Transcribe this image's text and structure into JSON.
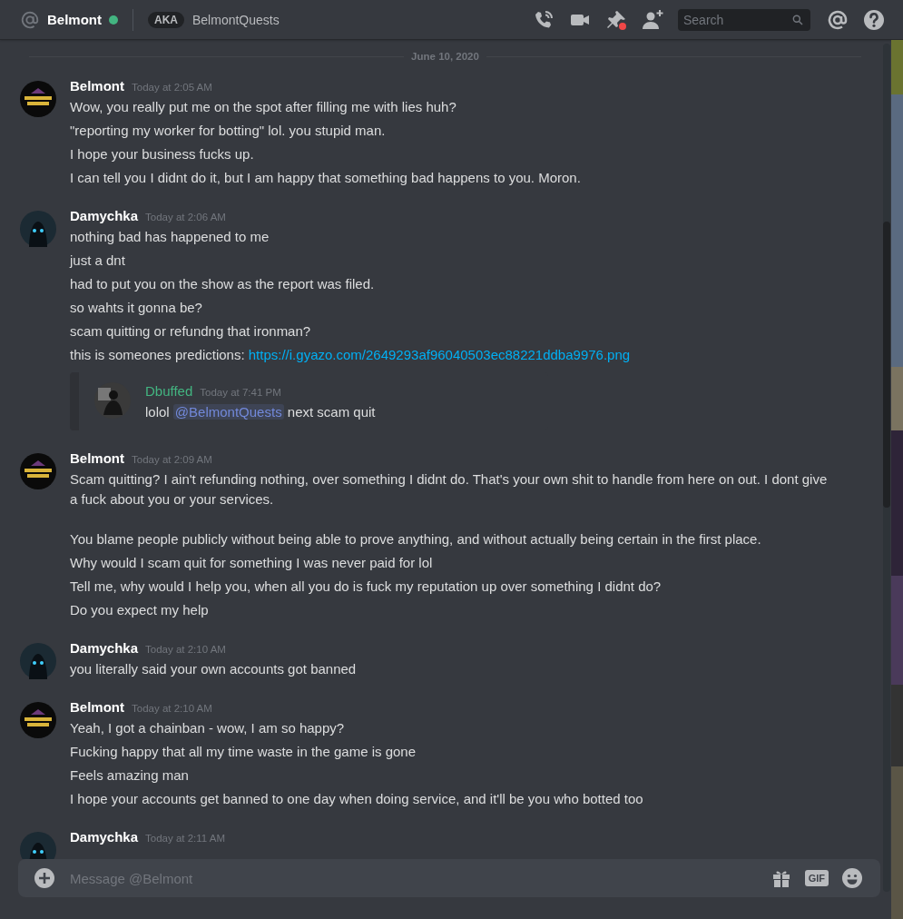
{
  "header": {
    "title": "Belmont",
    "online": true,
    "aka_badge": "AKA",
    "aka_name": "BelmontQuests",
    "search_placeholder": "Search"
  },
  "date_divider": "June 10, 2020",
  "messages": [
    {
      "author": "Belmont",
      "kind": "logo",
      "color": "#ffffff",
      "time": "Today at 2:05 AM",
      "paragraphs": [
        [
          [
            {
              "kind": "text",
              "text": "Wow, you really put me on the spot after filling me with lies huh?"
            }
          ],
          [
            {
              "kind": "text",
              "text": "\"reporting my worker for botting\" lol. you stupid man."
            }
          ],
          [
            {
              "kind": "text",
              "text": "I hope your business fucks up."
            }
          ],
          [
            {
              "kind": "text",
              "text": "I can tell you I didnt do it, but I am happy that something bad happens to you. Moron."
            }
          ]
        ]
      ]
    },
    {
      "author": "Damychka",
      "kind": "mask",
      "color": "#ffffff",
      "time": "Today at 2:06 AM",
      "paragraphs": [
        [
          [
            {
              "kind": "text",
              "text": "nothing bad has happened to me"
            }
          ],
          [
            {
              "kind": "text",
              "text": "just a dnt"
            }
          ],
          [
            {
              "kind": "text",
              "text": "had to put you on the show as the report was filed."
            }
          ],
          [
            {
              "kind": "text",
              "text": "so wahts it gonna be?"
            }
          ],
          [
            {
              "kind": "text",
              "text": "scam quitting or refundng that ironman?"
            }
          ],
          [
            {
              "kind": "text",
              "text": "this is someones predictions:"
            },
            {
              "kind": "link",
              "text": "https://i.gyazo.com/2649293af96040503ec88221ddba9976.png"
            }
          ]
        ]
      ],
      "embed": {
        "author": "Dbuffed",
        "color": "#43b581",
        "time": "Today at 7:41 PM",
        "parts": [
          {
            "kind": "text",
            "text": "lolol"
          },
          {
            "kind": "mention",
            "text": "@BelmontQuests"
          },
          {
            "kind": "text",
            "text": "next scam quit"
          }
        ]
      }
    },
    {
      "author": "Belmont",
      "kind": "logo",
      "color": "#ffffff",
      "time": "Today at 2:09 AM",
      "paragraphs": [
        [
          [
            {
              "kind": "text",
              "text": "Scam quitting? I ain't refunding nothing, over something I didnt do. That's your own shit to handle from here on out. I dont give a fuck about you or your services."
            }
          ]
        ],
        [
          [
            {
              "kind": "text",
              "text": "You blame people publicly without being able to prove anything, and without actually being certain in the first place."
            }
          ],
          [
            {
              "kind": "text",
              "text": "Why would I scam quit for something I was never paid for lol"
            }
          ],
          [
            {
              "kind": "text",
              "text": "Tell me, why would I help you, when all you do is fuck my reputation up over something I didnt do?"
            }
          ],
          [
            {
              "kind": "text",
              "text": "Do you expect my help"
            }
          ]
        ]
      ]
    },
    {
      "author": "Damychka",
      "kind": "mask",
      "color": "#ffffff",
      "time": "Today at 2:10 AM",
      "paragraphs": [
        [
          [
            {
              "kind": "text",
              "text": "you literally said your own accounts got banned"
            }
          ]
        ]
      ]
    },
    {
      "author": "Belmont",
      "kind": "logo",
      "color": "#ffffff",
      "time": "Today at 2:10 AM",
      "paragraphs": [
        [
          [
            {
              "kind": "text",
              "text": "Yeah, I got a chainban - wow, I am so happy?"
            }
          ],
          [
            {
              "kind": "text",
              "text": "Fucking happy that all my time waste in the game is gone"
            }
          ],
          [
            {
              "kind": "text",
              "text": "Feels amazing man"
            }
          ],
          [
            {
              "kind": "text",
              "text": "I hope your accounts get banned to one day when doing service, and it'll be you who botted too"
            }
          ]
        ]
      ]
    },
    {
      "author": "Damychka",
      "kind": "mask",
      "color": "#ffffff",
      "time": "Today at 2:11 AM"
    }
  ],
  "composer": {
    "placeholder": "Message @Belmont",
    "gif_label": "GIF"
  }
}
